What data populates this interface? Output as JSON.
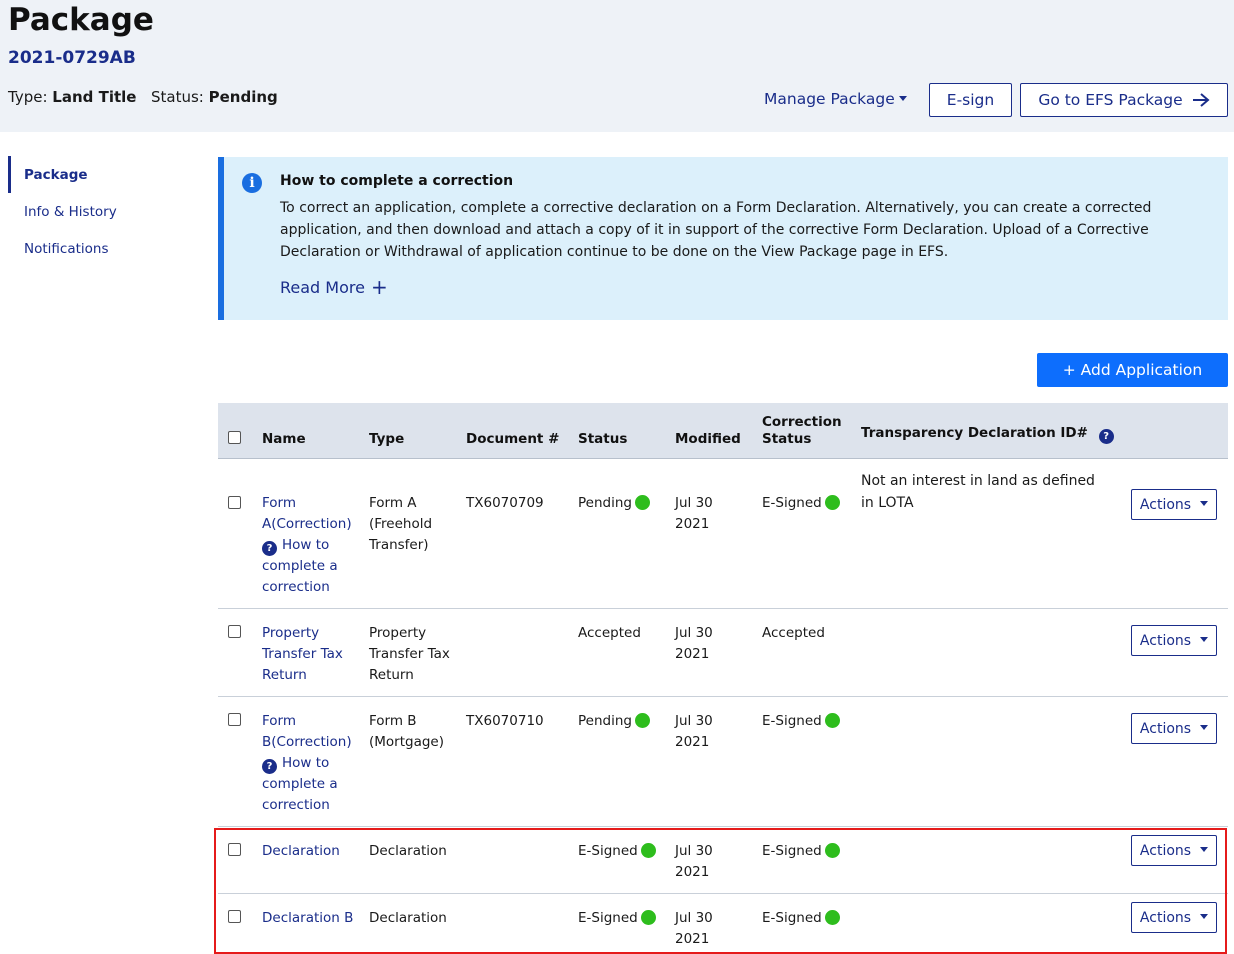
{
  "header": {
    "title": "Package",
    "package_number": "2021-0729AB",
    "type_label": "Type:",
    "type_value": "Land Title",
    "status_label": "Status:",
    "status_value": "Pending",
    "manage_label": "Manage Package",
    "esign_label": "E-sign",
    "efs_label": "Go to EFS Package"
  },
  "nav": {
    "items": [
      {
        "label": "Package",
        "active": true
      },
      {
        "label": "Info & History",
        "active": false
      },
      {
        "label": "Notifications",
        "active": false
      }
    ]
  },
  "info": {
    "title": "How to complete a correction",
    "body": "To correct an application, complete a corrective declaration on a Form Declaration. Alternatively, you can create a corrected application, and then download and attach a copy of it in support of the corrective Form Declaration. Upload of a Corrective Declaration or Withdrawal of application continue to be done on the View Package page in EFS.",
    "read_more": "Read More"
  },
  "add_application_label": "+ Add Application",
  "table": {
    "headers": {
      "name": "Name",
      "type": "Type",
      "document": "Document #",
      "status": "Status",
      "modified": "Modified",
      "correction_line1": "Correction",
      "correction_line2": "Status",
      "transparency": "Transparency Declaration ID#"
    },
    "actions_label": "Actions",
    "rows": [
      {
        "name": "Form A(Correction)",
        "help_text": "How to complete a correction",
        "type": "Form A (Freehold Transfer)",
        "document": "TX6070709",
        "status": "Pending",
        "modified": "Jul 30 2021",
        "correction": "E-Signed",
        "transparency": "Not an interest in land as defined in LOTA"
      },
      {
        "name": "Property Transfer Tax Return",
        "type": "Property Transfer Tax Return",
        "document": "",
        "status": "Accepted",
        "modified": "Jul 30 2021",
        "correction": "Accepted",
        "transparency": ""
      },
      {
        "name": "Form B(Correction)",
        "help_text": "How to complete a correction",
        "type": "Form B (Mortgage)",
        "document": "TX6070710",
        "status": "Pending",
        "modified": "Jul 30 2021",
        "correction": "E-Signed",
        "transparency": ""
      },
      {
        "name": "Declaration",
        "type": "Declaration",
        "document": "",
        "status": "E-Signed",
        "modified": "Jul 30 2021",
        "correction": "E-Signed",
        "transparency": ""
      },
      {
        "name": "Declaration B",
        "type": "Declaration",
        "document": "",
        "status": "E-Signed",
        "modified": "Jul 30 2021",
        "correction": "E-Signed",
        "transparency": ""
      }
    ]
  },
  "colors": {
    "brand": "#1a2d8a",
    "primary": "#0d6efd",
    "status_ok": "#2ebd1d",
    "highlight": "#e51b1b"
  }
}
